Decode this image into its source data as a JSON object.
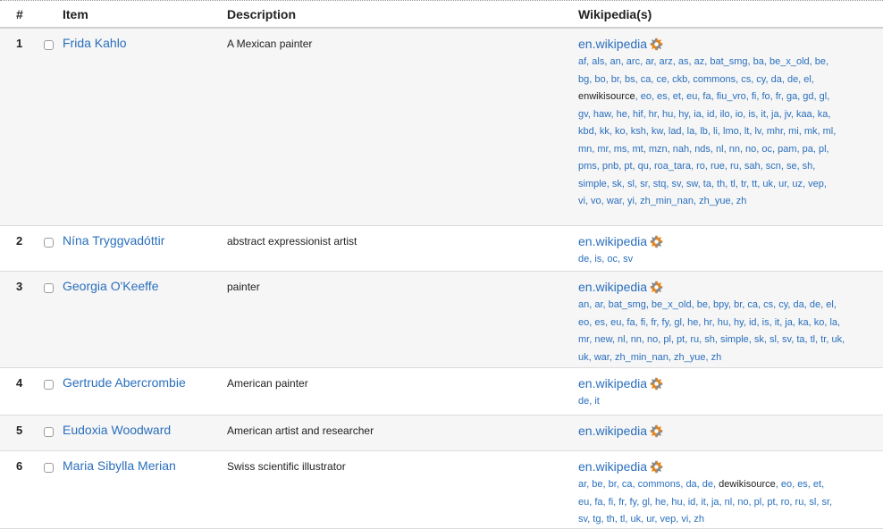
{
  "header": {
    "num": "#",
    "item": "Item",
    "description": "Description",
    "wikipedias": "Wikipedia(s)"
  },
  "colors": {
    "link": "#2a6fbd",
    "gear_orange": "#e3851f",
    "gear_gray": "#8a8a8a"
  },
  "rows": [
    {
      "num": "1",
      "item": "Frida Kahlo",
      "description": "A Mexican painter",
      "enwiki": "en.wikipedia",
      "lang_lines": [
        "af, als, an, arc, ar, arz, as, az, bat_smg, ba, be_x_old, be,",
        "bg, bo, br, bs, ca, ce, ckb, commons, cs, cy, da, de, el,",
        "enwikisource, eo, es, et, eu, fa, fiu_vro, fi, fo, fr, ga, gd, gl,",
        "gv, haw, he, hif, hr, hu, hy, ia, id, ilo, io, is, it, ja, jv, kaa, ka,",
        "kbd, kk, ko, ksh, kw, lad, la, lb, li, lmo, lt, lv, mhr, mi, mk, ml,",
        "mn, mr, ms, mt, mzn, nah, nds, nl, nn, no, oc, pam, pa, pl,",
        "pms, pnb, pt, qu, roa_tara, ro, rue, ru, sah, scn, se, sh,",
        "simple, sk, sl, sr, stq, sv, sw, ta, th, tl, tr, tt, uk, ur, uz, vep,",
        "vi, vo, war, yi, zh_min_nan, zh_yue, zh"
      ]
    },
    {
      "num": "2",
      "item": "Nína Tryggvadóttir",
      "description": "abstract expressionist artist",
      "enwiki": "en.wikipedia",
      "lang_lines": [
        "de, is, oc, sv"
      ]
    },
    {
      "num": "3",
      "item": "Georgia O'Keeffe",
      "description": "painter",
      "enwiki": "en.wikipedia",
      "lang_lines": [
        "an, ar, bat_smg, be_x_old, be, bpy, br, ca, cs, cy, da, de, el,",
        "eo, es, eu, fa, fi, fr, fy, gl, he, hr, hu, hy, id, is, it, ja, ka, ko, la,",
        "mr, new, nl, nn, no, pl, pt, ru, sh, simple, sk, sl, sv, ta, tl, tr, uk,",
        "uk, war, zh_min_nan, zh_yue, zh"
      ]
    },
    {
      "num": "4",
      "item": "Gertrude Abercrombie",
      "description": "American painter",
      "enwiki": "en.wikipedia",
      "lang_lines": [
        "de, it"
      ]
    },
    {
      "num": "5",
      "item": "Eudoxia Woodward",
      "description": "American artist and researcher",
      "enwiki": "en.wikipedia",
      "lang_lines": []
    },
    {
      "num": "6",
      "item": "Maria Sibylla Merian",
      "description": "Swiss scientific illustrator",
      "enwiki": "en.wikipedia",
      "lang_lines": [
        "ar, be, br, ca, commons, da, de, dewikisource, eo, es, et,",
        "eu, fa, fi, fr, fy, gl, he, hu, id, it, ja, nl, no, pl, pt, ro, ru, sl, sr,",
        "sv, tg, th, tl, uk, ur, vep, vi, zh"
      ]
    }
  ]
}
